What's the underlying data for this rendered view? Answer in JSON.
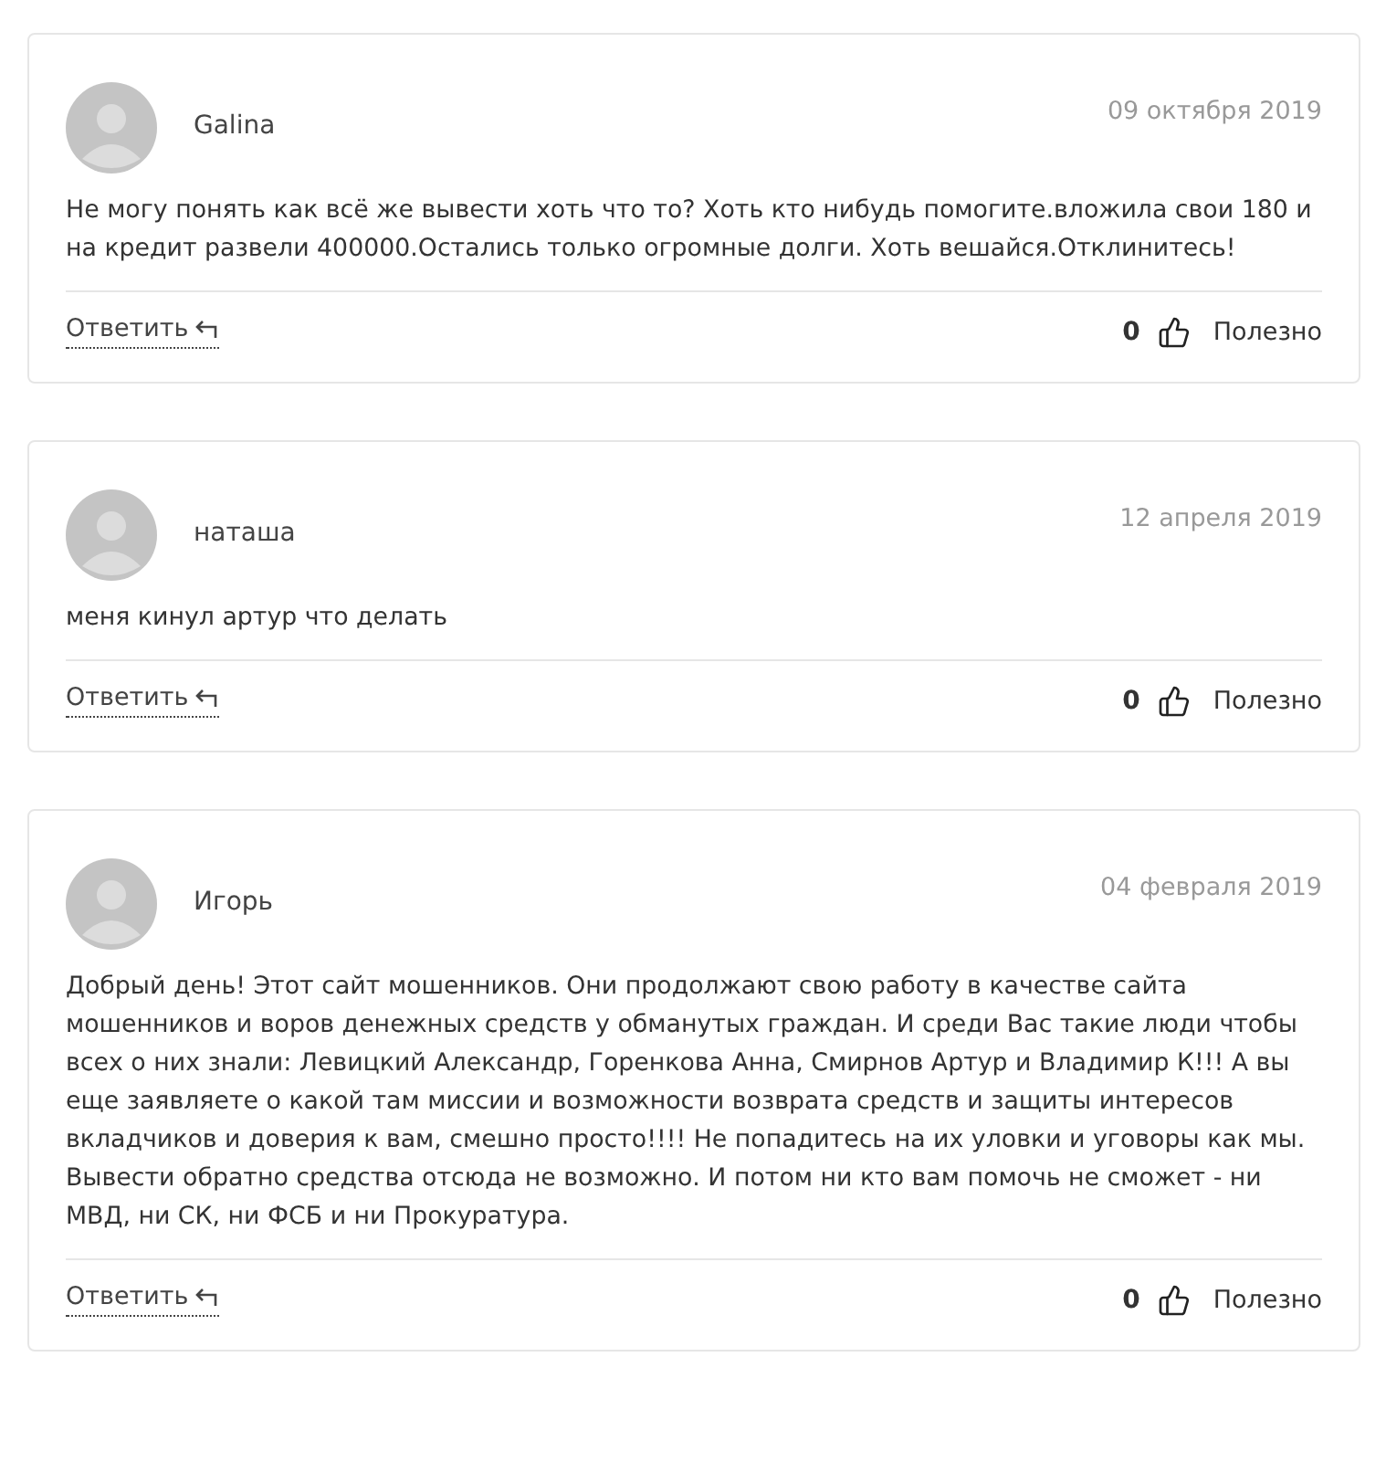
{
  "comments": [
    {
      "author": "Galina",
      "date": "09 октября 2019",
      "text": "Не могу понять как всё же вывести хоть что то? Хоть кто нибудь помогите.вложила свои 180 и на кредит развели 400000.Остались только огромные долги. Хоть вешайся.Отклинитесь!",
      "reply": "Ответить",
      "likes": "0",
      "useful": "Полезно"
    },
    {
      "author": "наташа",
      "date": "12 апреля 2019",
      "text": "меня кинул артур что делать",
      "reply": "Ответить",
      "likes": "0",
      "useful": "Полезно"
    },
    {
      "author": "Игорь",
      "date": "04 февраля 2019",
      "text": "Добрый день! Этот сайт мошенников. Они продолжают свою работу в качестве сайта мошенников и воров денежных средств у обманутых граждан. И среди Вас такие люди чтобы всех о них знали: Левицкий Александр, Горенкова Анна, Смирнов Артур и Владимир К!!! А вы еще заявляете о какой там миссии и возможности возврата средств и защиты интересов вкладчиков и доверия к вам, смешно просто!!!! Не попадитесь на их уловки и уговоры как мы. Вывести обратно средства отсюда не возможно. И потом ни кто вам помочь не сможет - ни МВД, ни СК, ни ФСБ и ни Прокуратура.",
      "reply": "Ответить",
      "likes": "0",
      "useful": "Полезно"
    }
  ]
}
